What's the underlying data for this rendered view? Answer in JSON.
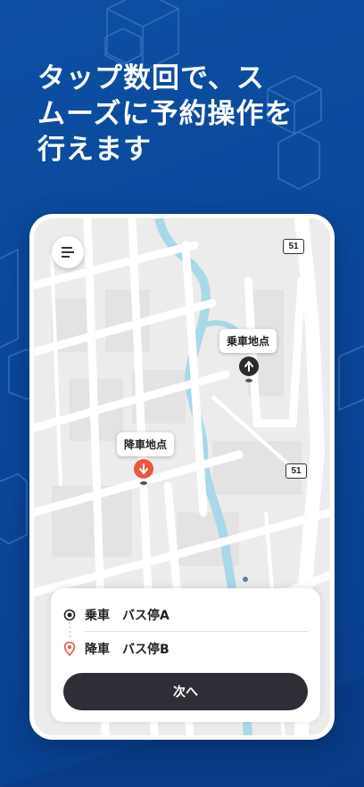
{
  "headline": "タップ数回で、ス\nムーズに予約操作を\n行えます",
  "map": {
    "route_badge_top": "51",
    "route_badge_mid": "51",
    "pickup_callout": "乗車地点",
    "dropoff_callout": "降車地点"
  },
  "sheet": {
    "pickup_kind": "乗車",
    "pickup_name": "バス停A",
    "dropoff_kind": "降車",
    "dropoff_name": "バス停B",
    "next_button": "次へ"
  },
  "colors": {
    "background": "#0b4a9e",
    "dropoff_pin": "#e9573f",
    "pickup_pin": "#2b2b2b",
    "button": "#2e2f36"
  }
}
